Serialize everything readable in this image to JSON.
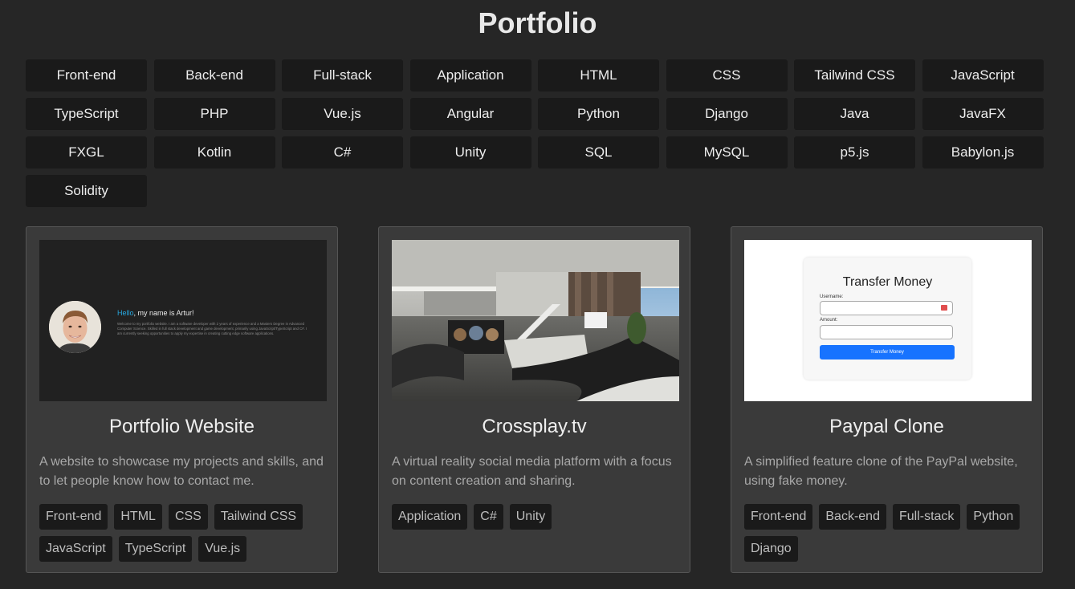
{
  "page": {
    "title": "Portfolio"
  },
  "filters": [
    "Front-end",
    "Back-end",
    "Full-stack",
    "Application",
    "HTML",
    "CSS",
    "Tailwind CSS",
    "JavaScript",
    "TypeScript",
    "PHP",
    "Vue.js",
    "Angular",
    "Python",
    "Django",
    "Java",
    "JavaFX",
    "FXGL",
    "Kotlin",
    "C#",
    "Unity",
    "SQL",
    "MySQL",
    "p5.js",
    "Babylon.js",
    "Solidity"
  ],
  "projects": [
    {
      "title": "Portfolio Website",
      "description": "A website to showcase my projects and skills, and to let people know how to contact me.",
      "tags": [
        "Front-end",
        "HTML",
        "CSS",
        "Tailwind CSS",
        "JavaScript",
        "TypeScript",
        "Vue.js"
      ],
      "preview": {
        "hello_accent": "Hello",
        "hello_rest": ", my name is Artur!",
        "bio": "Welcome to my portfolio website. I am a software developer with 2 years of experience and a Masters Degree in Advanced Computer Science. Skilled in full stack development and game development, primarily using JavaScript/TypeScript and C#. I am currently seeking opportunities to apply my expertise in creating cutting edge software applications."
      }
    },
    {
      "title": "Crossplay.tv",
      "description": "A virtual reality social media platform with a focus on content creation and sharing.",
      "tags": [
        "Application",
        "C#",
        "Unity"
      ]
    },
    {
      "title": "Paypal Clone",
      "description": "A simplified feature clone of the PayPal website, using fake money.",
      "tags": [
        "Front-end",
        "Back-end",
        "Full-stack",
        "Python",
        "Django"
      ],
      "preview": {
        "heading": "Transfer Money",
        "username_label": "Username:",
        "amount_label": "Amount:",
        "submit_label": "Transfer Money"
      }
    }
  ],
  "colors": {
    "background": "#262626",
    "button": "#1a1a1a",
    "card": "#3a3a3a",
    "accent": "#27a8e0",
    "paypal_blue": "#1773ff"
  }
}
